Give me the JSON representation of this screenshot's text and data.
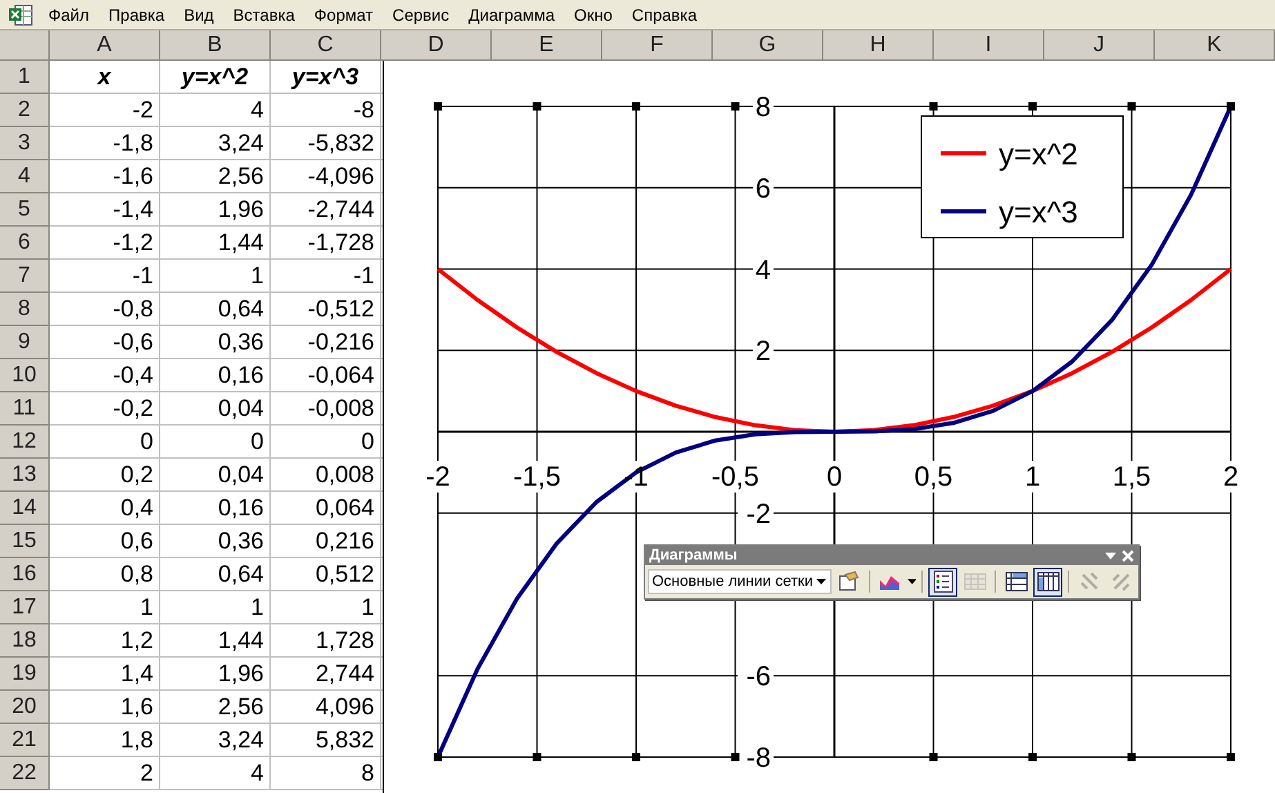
{
  "menu": [
    "Файл",
    "Правка",
    "Вид",
    "Вставка",
    "Формат",
    "Сервис",
    "Диаграмма",
    "Окно",
    "Справка"
  ],
  "sheet": {
    "columns": [
      "A",
      "B",
      "C",
      "D",
      "E",
      "F",
      "G",
      "H",
      "I",
      "J",
      "K"
    ],
    "rows": [
      {
        "number": "1",
        "kind": "header",
        "cells": [
          "x",
          "y=x^2",
          "y=x^3"
        ]
      },
      {
        "number": "2",
        "kind": "data",
        "cells": [
          "-2",
          "4",
          "-8"
        ]
      },
      {
        "number": "3",
        "kind": "data",
        "cells": [
          "-1,8",
          "3,24",
          "-5,832"
        ]
      },
      {
        "number": "4",
        "kind": "data",
        "cells": [
          "-1,6",
          "2,56",
          "-4,096"
        ]
      },
      {
        "number": "5",
        "kind": "data",
        "cells": [
          "-1,4",
          "1,96",
          "-2,744"
        ]
      },
      {
        "number": "6",
        "kind": "data",
        "cells": [
          "-1,2",
          "1,44",
          "-1,728"
        ]
      },
      {
        "number": "7",
        "kind": "data",
        "cells": [
          "-1",
          "1",
          "-1"
        ]
      },
      {
        "number": "8",
        "kind": "data",
        "cells": [
          "-0,8",
          "0,64",
          "-0,512"
        ]
      },
      {
        "number": "9",
        "kind": "data",
        "cells": [
          "-0,6",
          "0,36",
          "-0,216"
        ]
      },
      {
        "number": "10",
        "kind": "data",
        "cells": [
          "-0,4",
          "0,16",
          "-0,064"
        ]
      },
      {
        "number": "11",
        "kind": "data",
        "cells": [
          "-0,2",
          "0,04",
          "-0,008"
        ]
      },
      {
        "number": "12",
        "kind": "data",
        "cells": [
          "0",
          "0",
          "0"
        ]
      },
      {
        "number": "13",
        "kind": "data",
        "cells": [
          "0,2",
          "0,04",
          "0,008"
        ]
      },
      {
        "number": "14",
        "kind": "data",
        "cells": [
          "0,4",
          "0,16",
          "0,064"
        ]
      },
      {
        "number": "15",
        "kind": "data",
        "cells": [
          "0,6",
          "0,36",
          "0,216"
        ]
      },
      {
        "number": "16",
        "kind": "data",
        "cells": [
          "0,8",
          "0,64",
          "0,512"
        ]
      },
      {
        "number": "17",
        "kind": "data",
        "cells": [
          "1",
          "1",
          "1"
        ]
      },
      {
        "number": "18",
        "kind": "data",
        "cells": [
          "1,2",
          "1,44",
          "1,728"
        ]
      },
      {
        "number": "19",
        "kind": "data",
        "cells": [
          "1,4",
          "1,96",
          "2,744"
        ]
      },
      {
        "number": "20",
        "kind": "data",
        "cells": [
          "1,6",
          "2,56",
          "4,096"
        ]
      },
      {
        "number": "21",
        "kind": "data",
        "cells": [
          "1,8",
          "3,24",
          "5,832"
        ]
      },
      {
        "number": "22",
        "kind": "data",
        "cells": [
          "2",
          "4",
          "8"
        ]
      }
    ]
  },
  "chart": {
    "gridlines_selected": true,
    "chart_data": {
      "type": "line",
      "grid": true,
      "legend": true,
      "x": [
        -2,
        -1.8,
        -1.6,
        -1.4,
        -1.2,
        -1,
        -0.8,
        -0.6,
        -0.4,
        -0.2,
        0,
        0.2,
        0.4,
        0.6,
        0.8,
        1,
        1.2,
        1.4,
        1.6,
        1.8,
        2
      ],
      "series": [
        {
          "name": "y=x^2",
          "color": "#ff0000",
          "values": [
            4,
            3.24,
            2.56,
            1.96,
            1.44,
            1,
            0.64,
            0.36,
            0.16,
            0.04,
            0,
            0.04,
            0.16,
            0.36,
            0.64,
            1,
            1.44,
            1.96,
            2.56,
            3.24,
            4
          ]
        },
        {
          "name": "y=x^3",
          "color": "#000080",
          "values": [
            -8,
            -5.832,
            -4.096,
            -2.744,
            -1.728,
            -1,
            -0.512,
            -0.216,
            -0.064,
            -0.008,
            0,
            0.008,
            0.064,
            0.216,
            0.512,
            1,
            1.728,
            2.744,
            4.096,
            5.832,
            8
          ]
        }
      ],
      "xlim": [
        -2,
        2
      ],
      "ylim": [
        -8,
        8
      ],
      "xticks": [
        {
          "value": -2,
          "label": "-2"
        },
        {
          "value": -1.5,
          "label": "-1,5"
        },
        {
          "value": -1,
          "label": "-1"
        },
        {
          "value": -0.5,
          "label": "-0,5"
        },
        {
          "value": 0,
          "label": "0"
        },
        {
          "value": 0.5,
          "label": "0,5"
        },
        {
          "value": 1,
          "label": "1"
        },
        {
          "value": 1.5,
          "label": "1,5"
        },
        {
          "value": 2,
          "label": "2"
        }
      ],
      "yticks": [
        {
          "value": -8,
          "label": "-8"
        },
        {
          "value": -6,
          "label": "-6"
        },
        {
          "value": -2,
          "label": "-2"
        },
        {
          "value": 2,
          "label": "2"
        },
        {
          "value": 4,
          "label": "4"
        },
        {
          "value": 6,
          "label": "6"
        },
        {
          "value": 8,
          "label": "8"
        }
      ]
    }
  },
  "toolbar": {
    "title": "Диаграммы",
    "element": "Основные линии сетки",
    "tools": [
      {
        "kind": "format",
        "pressed": false,
        "disabled": false
      },
      {
        "kind": "chart-type",
        "pressed": false,
        "disabled": false
      },
      {
        "kind": "legend",
        "pressed": true,
        "disabled": false
      },
      {
        "kind": "data-table",
        "pressed": false,
        "disabled": true
      },
      {
        "kind": "by-rows",
        "pressed": false,
        "disabled": false
      },
      {
        "kind": "by-columns",
        "pressed": true,
        "disabled": false
      },
      {
        "kind": "angle-down",
        "pressed": false,
        "disabled": true
      },
      {
        "kind": "angle-up",
        "pressed": false,
        "disabled": true
      }
    ]
  }
}
